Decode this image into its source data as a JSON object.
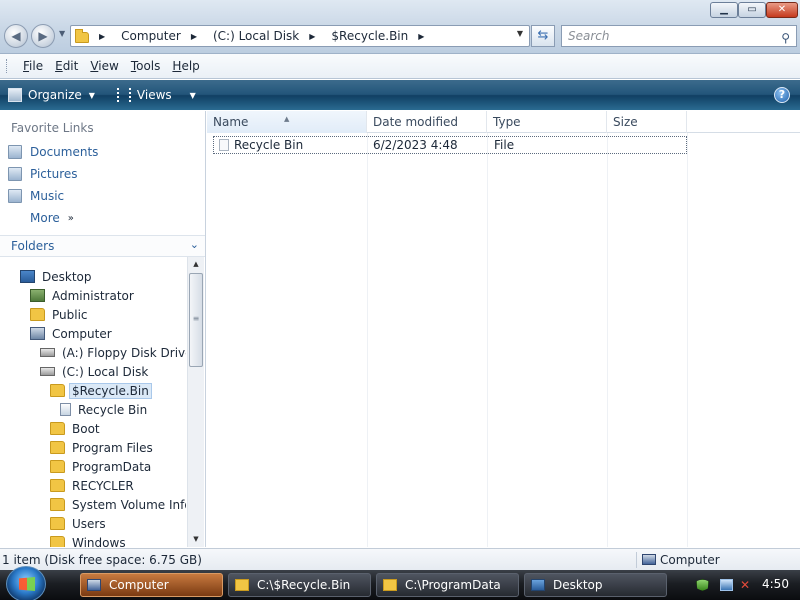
{
  "window": {
    "address_crumbs": [
      {
        "label": "Computer"
      },
      {
        "label": "(C:) Local Disk"
      },
      {
        "label": "$Recycle.Bin"
      }
    ],
    "search_placeholder": "Search"
  },
  "menu": {
    "items": [
      "File",
      "Edit",
      "View",
      "Tools",
      "Help"
    ],
    "underline": [
      "F",
      "E",
      "V",
      "T",
      "H"
    ]
  },
  "commandbar": {
    "organize_label": "Organize",
    "views_label": "Views",
    "help_label": "?"
  },
  "navpane": {
    "favorite_title": "Favorite Links",
    "favorites": [
      "Documents",
      "Pictures",
      "Music"
    ],
    "more_label": "More",
    "folders_title": "Folders",
    "tree": [
      {
        "label": "Desktop",
        "icon": "desktop-icon",
        "indent": 0
      },
      {
        "label": "Administrator",
        "icon": "user-folder-icon",
        "indent": 1
      },
      {
        "label": "Public",
        "icon": "folder-icon",
        "indent": 1
      },
      {
        "label": "Computer",
        "icon": "computer-icon",
        "indent": 1
      },
      {
        "label": "(A:) Floppy Disk Drive",
        "icon": "floppy-drive-icon",
        "indent": 2
      },
      {
        "label": "(C:) Local Disk",
        "icon": "local-disk-icon",
        "indent": 2
      },
      {
        "label": "$Recycle.Bin",
        "icon": "folder-icon",
        "indent": 3,
        "selected": true
      },
      {
        "label": "Recycle Bin",
        "icon": "recycle-bin-icon",
        "indent": 4
      },
      {
        "label": "Boot",
        "icon": "folder-icon",
        "indent": 3
      },
      {
        "label": "Program Files",
        "icon": "folder-icon",
        "indent": 3
      },
      {
        "label": "ProgramData",
        "icon": "folder-icon",
        "indent": 3
      },
      {
        "label": "RECYCLER",
        "icon": "folder-icon",
        "indent": 3
      },
      {
        "label": "System Volume Inforr",
        "icon": "folder-icon",
        "indent": 3
      },
      {
        "label": "Users",
        "icon": "folder-icon",
        "indent": 3
      },
      {
        "label": "Windows",
        "icon": "folder-icon",
        "indent": 3
      }
    ]
  },
  "filelist": {
    "columns": [
      "Name",
      "Date modified",
      "Type",
      "Size"
    ],
    "sort_column": "Name",
    "rows": [
      {
        "name": "Recycle Bin",
        "date_modified": "6/2/2023 4:48",
        "type": "File",
        "size": ""
      }
    ]
  },
  "statusbar": {
    "text": "1 item (Disk free space: 6.75 GB)",
    "location": "Computer"
  },
  "taskbar": {
    "buttons": [
      {
        "label": "Computer",
        "icon": "computer-icon",
        "active": true
      },
      {
        "label": "C:\\$Recycle.Bin",
        "icon": "folder-icon",
        "active": false
      },
      {
        "label": "C:\\ProgramData",
        "icon": "folder-icon",
        "active": false
      },
      {
        "label": "Desktop",
        "icon": "desktop-icon",
        "active": false
      }
    ],
    "clock": "4:50"
  },
  "colors": {
    "command_bar": "#22557a",
    "link_text": "#2b5f9a",
    "selection": "#dbe9f7",
    "close_button": "#c53a1e"
  }
}
